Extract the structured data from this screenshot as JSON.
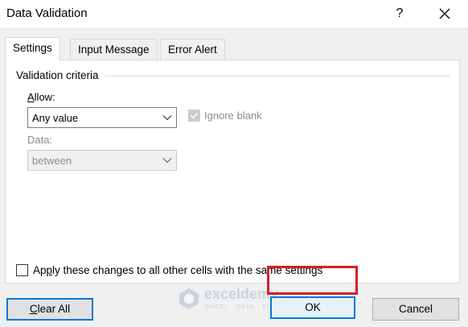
{
  "window": {
    "title": "Data Validation",
    "help_label": "?",
    "close_label": "✕"
  },
  "tabs": [
    {
      "label": "Settings",
      "active": true
    },
    {
      "label": "Input Message",
      "active": false
    },
    {
      "label": "Error Alert",
      "active": false
    }
  ],
  "settings": {
    "group_title": "Validation criteria",
    "allow_label_pre": "",
    "allow_label_u": "A",
    "allow_label_post": "llow:",
    "allow_value": "Any value",
    "ignore_blank_label": "Ignore blank",
    "ignore_blank_checked": true,
    "data_label": "Data:",
    "data_value": "between",
    "apply_label_pre": "Ap",
    "apply_label_u": "p",
    "apply_label_post": "ly these changes to all other cells with the same settings",
    "apply_checked": false
  },
  "buttons": {
    "clear_all_u": "C",
    "clear_all_post": "lear All",
    "ok": "OK",
    "cancel": "Cancel"
  },
  "watermark": {
    "name": "exceldemy",
    "tagline": "EXCEL · DATA · BI"
  },
  "colors": {
    "highlight": "#d21f2a",
    "focus": "#0078d7",
    "dialog_bg": "#f0f0f0"
  }
}
